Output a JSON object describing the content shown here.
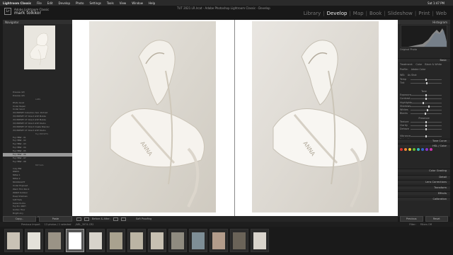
{
  "menubar": {
    "items": [
      "Lightroom Classic",
      "File",
      "Edit",
      "Develop",
      "Photo",
      "Settings",
      "Tools",
      "View",
      "Window",
      "Help"
    ],
    "clock": "Sat 1:47 PM"
  },
  "identity": {
    "line1": "Adobe Lightroom Classic",
    "line2": "mark tolkkor"
  },
  "window_title": "TUT 2021 LR.lrcat - Adobe Photoshop Lightroom Classic - Develop",
  "modules": [
    "Library",
    "Develop",
    "Map",
    "Book",
    "Slideshow",
    "Print",
    "Web"
  ],
  "active_module": "Develop",
  "left_panel": {
    "navigator_label": "Navigator",
    "presets": [
      "Preview (Af)",
      "Preview (Af)",
      "LABS",
      "Photo Good",
      "Under Repair",
      "Under Good",
      "(M) PRESET Collection Sub: Portrait",
      "(M) PRESET CT Direct LIVE Mobile",
      "(M) PRESET CT Direct LIVE Mobile",
      "(M) PRESET CT Direct LIVE Studio",
      "(M) PRESET CT Direct Create Blender",
      "(M) PRESET CT Direct LIVE Studio",
      "Fuji PRESETS",
      "Fuji HBW - 01",
      "Fuji HBW - 02",
      "Fuji HBW - 03",
      "Fuji HBW - 04",
      "Fuji HBW - 05",
      "Fuji HBW - 06",
      "Fuji HBW - 07",
      "Fuji HBW - 08",
      "BW Sets",
      "Cozy BW",
      "PARKS",
      "Mittel 1",
      "Mittel 2",
      "MOODLIGHT",
      "Under Exposed",
      "Warm Film Stock",
      "WARM Outdoor",
      "Deep Shadows",
      "Soft Fade",
      "Kodak Portra",
      "Fuji Pro 400H",
      "Golden Hour",
      "Bright Airy",
      "LABS",
      "Urban Film Warmth"
    ],
    "selected_preset_index": 18,
    "group_indexes": [
      2,
      12,
      21,
      36
    ],
    "copy_label": "Copy...",
    "paste_label": "Paste"
  },
  "toolbar": {
    "before_after": "Before & After:",
    "soft_proofing": "Soft Proofing"
  },
  "right_panel": {
    "histogram_label": "Histogram",
    "original_photo": "Original Photo",
    "basic_label": "Basic",
    "treatment": "Treatment:",
    "color": "Color",
    "bw": "Black & White",
    "profile": "Profile:",
    "profile_value": "Adobe Color",
    "wb_label": "WB:",
    "wb_value": "As Shot",
    "tone_label": "Tone",
    "tone_auto": "Auto",
    "presence_label": "Presence",
    "sliders": [
      {
        "name": "Temp",
        "value": 0.5
      },
      {
        "name": "Tint",
        "value": 0.52
      },
      {
        "name": "Exposure",
        "value": 0.5
      },
      {
        "name": "Contrast",
        "value": 0.5
      },
      {
        "name": "Highlights",
        "value": 0.4
      },
      {
        "name": "Shadows",
        "value": 0.6
      },
      {
        "name": "Whites",
        "value": 0.55
      },
      {
        "name": "Blacks",
        "value": 0.48
      },
      {
        "name": "Texture",
        "value": 0.5
      },
      {
        "name": "Clarity",
        "value": 0.5
      },
      {
        "name": "Dehaze",
        "value": 0.5
      },
      {
        "name": "Vibrance",
        "value": 0.5
      },
      {
        "name": "Saturation",
        "value": 0.5
      }
    ],
    "sections": [
      "Tone Curve",
      "HSL / Color",
      "Color Grading",
      "Detail",
      "Lens Corrections",
      "Transform",
      "Effects",
      "Calibration"
    ],
    "previous_label": "Previous",
    "reset_label": "Reset"
  },
  "filmstrip_bar": {
    "source": "Previous Import",
    "count": "13 photos / 1 selected",
    "file": "/ARL_3974.CR2",
    "filter": "Filter:",
    "filter_value": "Filters Off"
  },
  "filmstrip": [
    {
      "color": "#c9c2b5"
    },
    {
      "color": "#e4e1da"
    },
    {
      "color": "#9a9386"
    },
    {
      "color": "#ffffff"
    },
    {
      "color": "#d7d3cb"
    },
    {
      "color": "#a9a28f"
    },
    {
      "color": "#bbb4a4"
    },
    {
      "color": "#c7c0b2"
    },
    {
      "color": "#8f8b80"
    },
    {
      "color": "#7e8e96"
    },
    {
      "color": "#b39c8b"
    },
    {
      "color": "#6a6358"
    },
    {
      "color": "#d9d4cc"
    }
  ]
}
